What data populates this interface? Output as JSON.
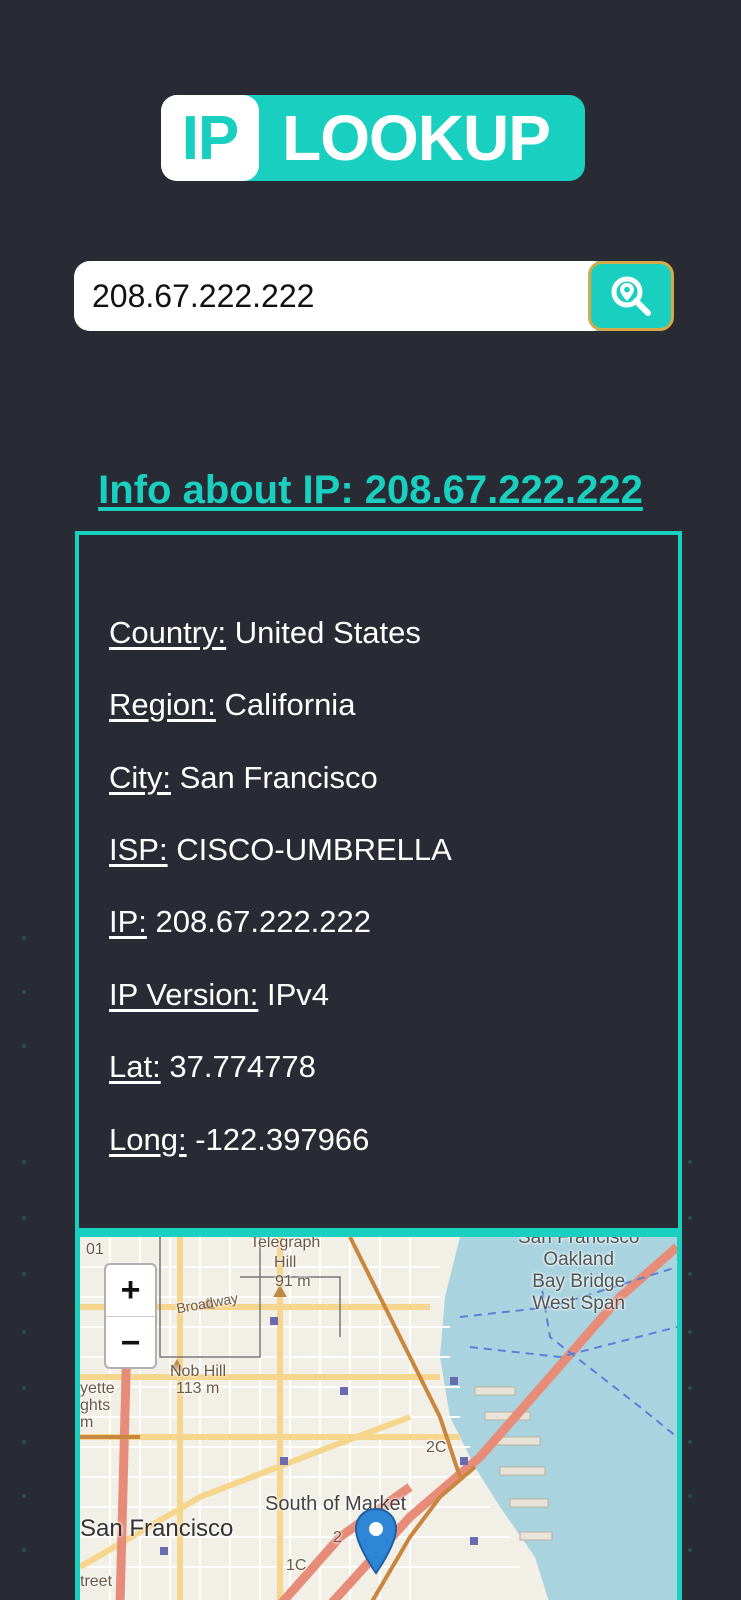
{
  "logo": {
    "ip": "IP",
    "lookup": "LOOKUP"
  },
  "search": {
    "value": "208.67.222.222",
    "button_icon": "search-location-icon"
  },
  "info": {
    "title": "Info about IP: 208.67.222.222",
    "rows": [
      {
        "label": "Country:",
        "value": "United States"
      },
      {
        "label": "Region:",
        "value": "California"
      },
      {
        "label": "City:",
        "value": "San Francisco"
      },
      {
        "label": "ISP:",
        "value": "CISCO-UMBRELLA"
      },
      {
        "label": "IP:",
        "value": "208.67.222.222"
      },
      {
        "label": "IP Version:",
        "value": "IPv4"
      },
      {
        "label": "Lat:",
        "value": "37.774778"
      },
      {
        "label": "Long:",
        "value": "-122.397966"
      }
    ]
  },
  "map": {
    "zoom_in": "+",
    "zoom_out": "−",
    "labels": {
      "telegraph_hill": "Telegraph\nHill",
      "telegraph_elev": "91 m",
      "broadway": "Broadway",
      "nob_hill": "Nob Hill",
      "nob_elev": "113 m",
      "bay_bridge": "San Francisco\nOakland\nBay Bridge\nWest Span",
      "south_of_market": "South of Market",
      "san_francisco": "San Francisco",
      "left_fragment_1": "yette",
      "left_fragment_2": "ghts",
      "left_fragment_3": "m",
      "left_fragment_4": "treet",
      "left_fragment_5": "01",
      "road_2c": "2C",
      "road_2": "2",
      "road_1c": "1C"
    },
    "marker_icon": "map-pin-icon",
    "colors": {
      "water": "#a9d3df",
      "land": "#f2efe6",
      "highway": "#e88c7a",
      "primary": "#f6d58c"
    }
  }
}
